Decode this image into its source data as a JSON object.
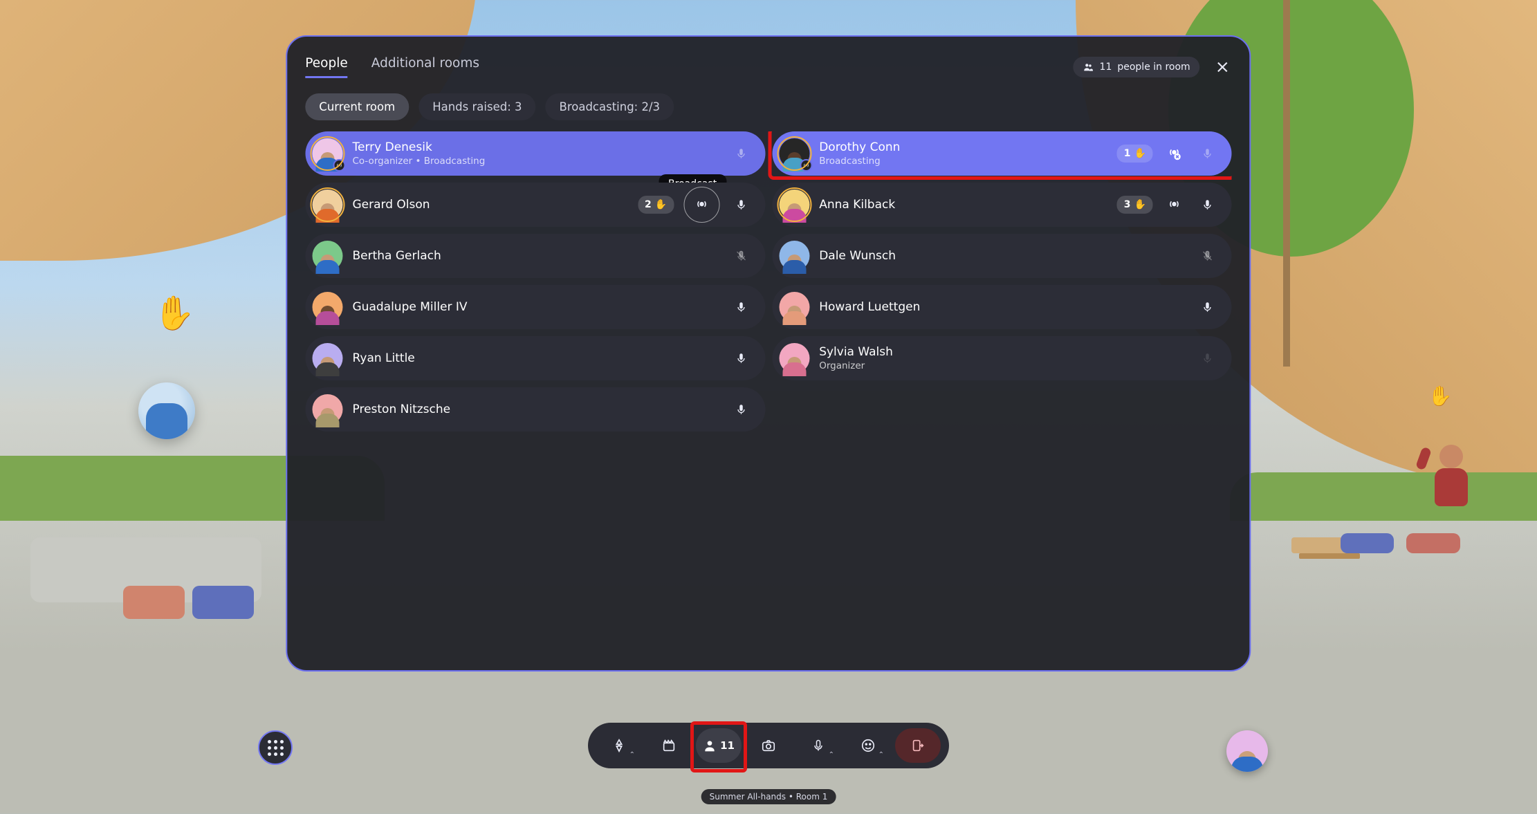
{
  "tabs": {
    "people": "People",
    "additional_rooms": "Additional rooms"
  },
  "header": {
    "people_in_room_count": "11",
    "people_in_room_label": "people in room"
  },
  "filters": {
    "current_room": "Current room",
    "hands_raised": "Hands raised: 3",
    "broadcasting": "Broadcasting: 2/3"
  },
  "tooltip_broadcast": "Broadcast",
  "people": {
    "left": [
      {
        "name": "Terry Denesik",
        "subtext": "Co-organizer • Broadcasting"
      },
      {
        "name": "Gerard Olson",
        "hand_order": "2"
      },
      {
        "name": "Bertha Gerlach"
      },
      {
        "name": "Guadalupe Miller IV"
      },
      {
        "name": "Ryan Little"
      },
      {
        "name": "Preston Nitzsche"
      }
    ],
    "right": [
      {
        "name": "Dorothy Conn",
        "subtext": "Broadcasting",
        "hand_order": "1"
      },
      {
        "name": "Anna Kilback",
        "hand_order": "3"
      },
      {
        "name": "Dale Wunsch"
      },
      {
        "name": "Howard Luettgen"
      },
      {
        "name": "Sylvia Walsh",
        "subtext": "Organizer"
      }
    ]
  },
  "bottom_bar": {
    "people_count": "11"
  },
  "room_caption": "Summer All-hands • Room 1",
  "icons": {
    "people": "people-icon",
    "close": "close-icon",
    "mic": "microphone-icon",
    "mic_muted": "microphone-muted-icon",
    "broadcast": "broadcast-icon",
    "broadcast_stop": "broadcast-stop-icon",
    "hand": "✋",
    "menu_grid": "menu-grid-icon",
    "navigate": "navigate-icon",
    "clapper": "clapperboard-icon",
    "camera": "camera-icon",
    "emoji": "emoji-icon",
    "leave": "leave-room-icon"
  },
  "avatar_colors": {
    "terry": {
      "bg": "#efc6e7",
      "shirt": "#2e6dc6",
      "ring": "#f2b23e"
    },
    "gerard": {
      "bg": "#f0cf9d",
      "shirt": "#e06a2b",
      "ring": "#f2b23e"
    },
    "bertha": {
      "bg": "#7cc98a",
      "shirt": "#2e6dc6"
    },
    "guadalupe": {
      "bg": "#f3a96b",
      "shirt": "#b64e9a",
      "skin": "#6f4b30"
    },
    "ryan": {
      "bg": "#b9adf0",
      "shirt": "#3e3e3e"
    },
    "preston": {
      "bg": "#f0a8a8",
      "shirt": "#a7996b"
    },
    "dorothy": {
      "bg": "#262626",
      "shirt": "#48a0c5",
      "ring": "#f2b23e",
      "skin": "#5a3d2b"
    },
    "anna": {
      "bg": "#f4d47a",
      "shirt": "#cc4aa0",
      "ring": "#f2b23e"
    },
    "dale": {
      "bg": "#8fb7e8",
      "shirt": "#2b5da9"
    },
    "howard": {
      "bg": "#f2a7a7",
      "shirt": "#e49b7a"
    },
    "sylvia": {
      "bg": "#f2a7c1",
      "shirt": "#d86f8f"
    }
  }
}
